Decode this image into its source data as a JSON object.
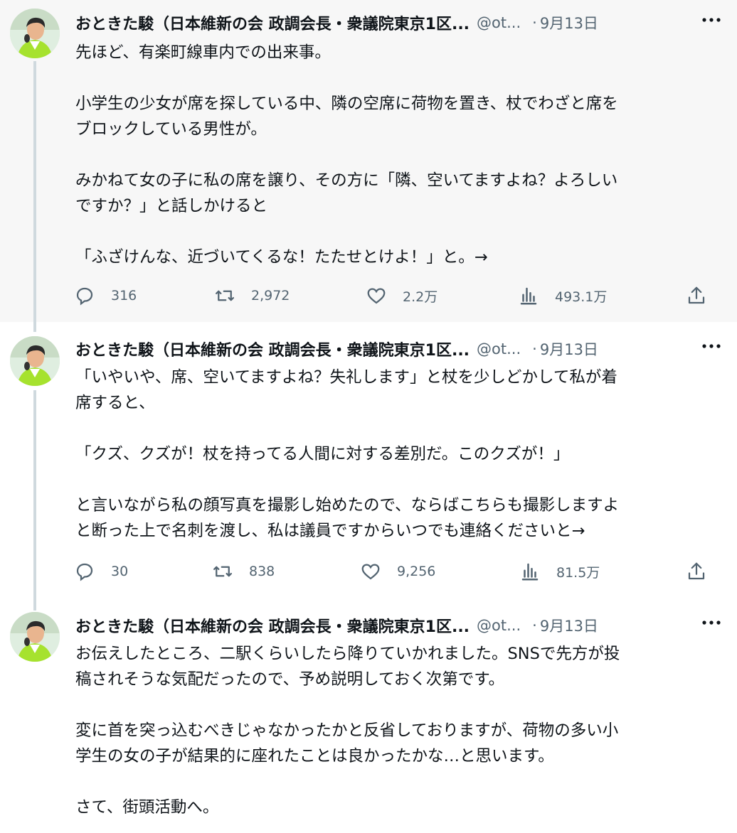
{
  "tweets": [
    {
      "author_name": "おときた駿（日本維新の会 政調会長・衆議院東京1区...",
      "handle": "@ot...",
      "separator": "·",
      "date": "9月13日",
      "paragraphs": [
        "先ほど、有楽町線車内での出来事。",
        "小学生の少女が席を探している中、隣の空席に荷物を置き、杖でわざと席を\nブロックしている男性が。",
        "みかねて女の子に私の席を譲り、その方に「隣、空いてますよね？よろしい\nですか？」と話しかけると",
        "「ふざけんな、近づいてくるな！たたせとけよ！」と。→"
      ],
      "replies": "316",
      "retweets": "2,972",
      "likes": "2.2万",
      "views": "493.1万"
    },
    {
      "author_name": "おときた駿（日本維新の会 政調会長・衆議院東京1区...",
      "handle": "@ot...",
      "separator": "·",
      "date": "9月13日",
      "paragraphs": [
        "「いやいや、席、空いてますよね？失礼します」と杖を少しどかして私が着\n席すると、",
        "「クズ、クズが！杖を持ってる人間に対する差別だ。このクズが！」",
        "と言いながら私の顔写真を撮影し始めたので、ならばこちらも撮影しますよ\nと断った上で名刺を渡し、私は議員ですからいつでも連絡くださいと→"
      ],
      "replies": "30",
      "retweets": "838",
      "likes": "9,256",
      "views": "81.5万"
    },
    {
      "author_name": "おときた駿（日本維新の会 政調会長・衆議院東京1区...",
      "handle": "@ot...",
      "separator": "·",
      "date": "9月13日",
      "paragraphs": [
        "お伝えしたところ、二駅くらいしたら降りていかれました。SNSで先方が投\n稿されそうな気配だったので、予め説明しておく次第です。",
        "変に首を突っ込むべきじゃなかったかと反省しておりますが、荷物の多い小\n学生の女の子が結果的に座れたことは良かったかな…と思います。",
        "さて、街頭活動へ。"
      ]
    }
  ],
  "icons": {
    "more": "more-horizontal-icon",
    "reply": "reply-bubble-icon",
    "retweet": "retweet-icon",
    "like": "heart-icon",
    "views": "views-bar-chart-icon",
    "share": "share-upload-icon"
  },
  "colors": {
    "text": "#0f1419",
    "secondary": "#536471",
    "thread_line": "#cfd9de",
    "highlight_bg": "#f7f7f7",
    "avatar_vest": "#a6e22e"
  }
}
